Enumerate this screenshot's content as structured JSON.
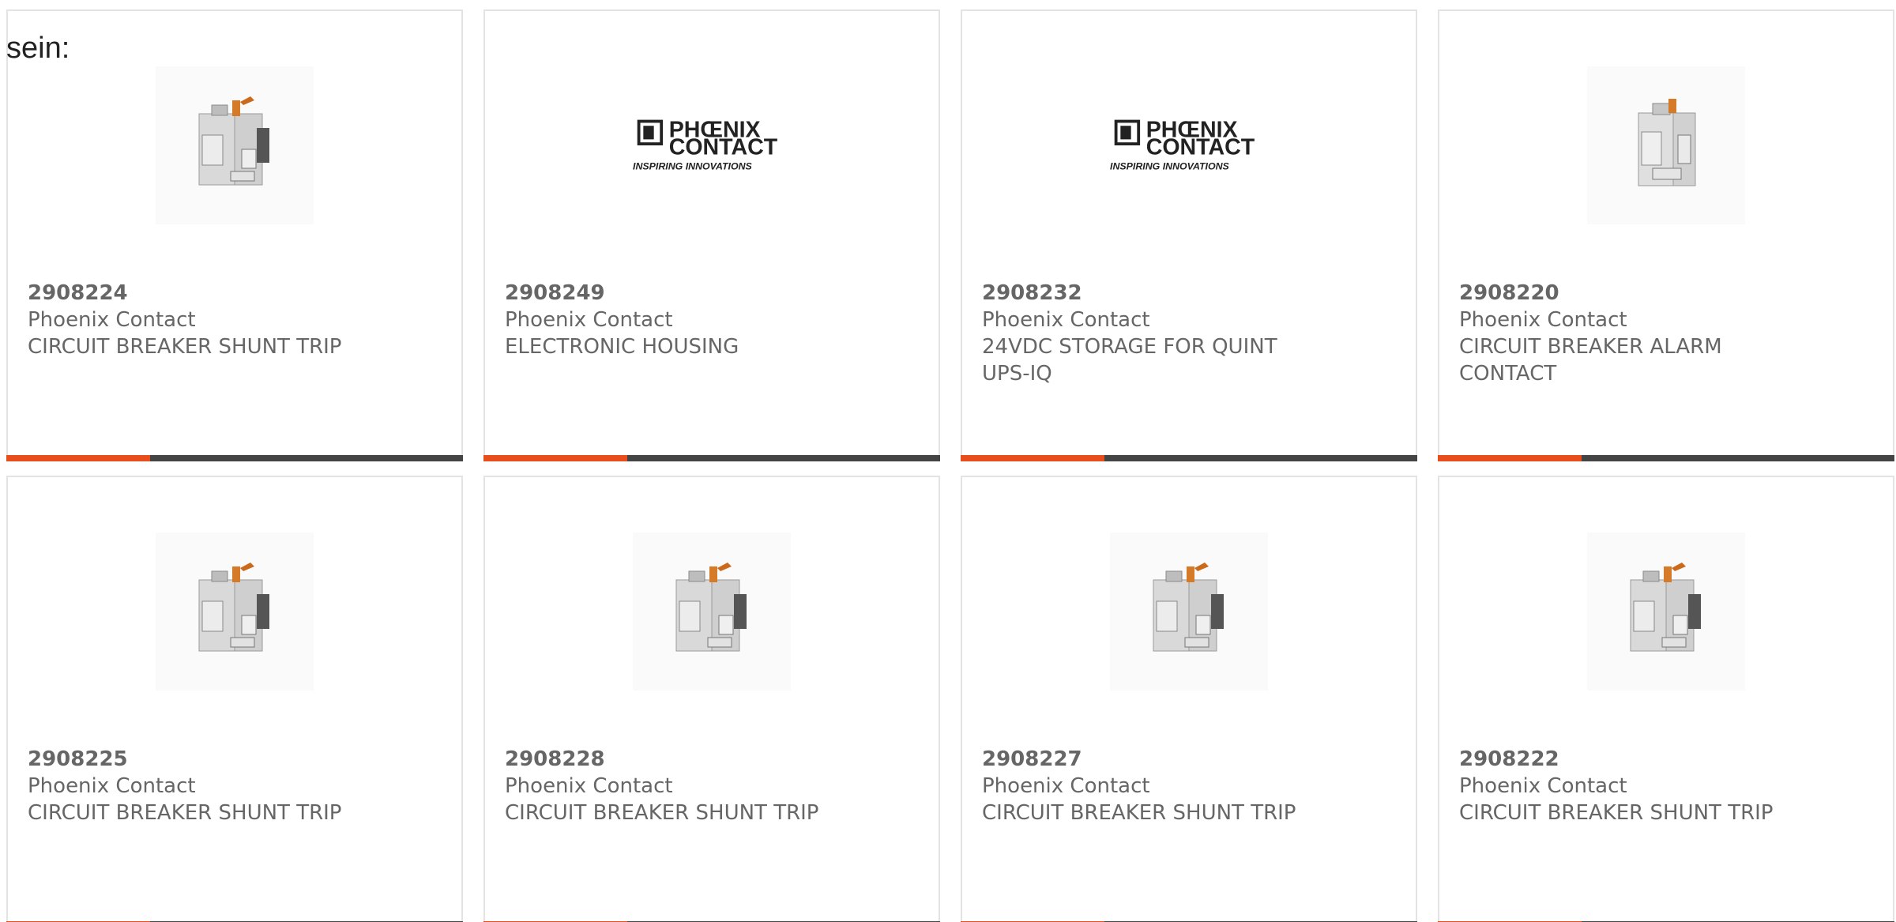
{
  "intro_text": "sein:",
  "products": [
    {
      "part_number": "2908224",
      "manufacturer": "Phoenix Contact",
      "description": "CIRCUIT BREAKER SHUNT TRIP",
      "image": "breaker"
    },
    {
      "part_number": "2908249",
      "manufacturer": "Phoenix Contact",
      "description": "ELECTRONIC HOUSING",
      "image": "logo"
    },
    {
      "part_number": "2908232",
      "manufacturer": "Phoenix Contact",
      "description": "24VDC STORAGE FOR QUINT UPS-IQ",
      "image": "logo"
    },
    {
      "part_number": "2908220",
      "manufacturer": "Phoenix Contact",
      "description": "CIRCUIT BREAKER ALARM CONTACT",
      "image": "breaker-alt"
    },
    {
      "part_number": "2908225",
      "manufacturer": "Phoenix Contact",
      "description": "CIRCUIT BREAKER SHUNT TRIP",
      "image": "breaker"
    },
    {
      "part_number": "2908228",
      "manufacturer": "Phoenix Contact",
      "description": "CIRCUIT BREAKER SHUNT TRIP",
      "image": "breaker"
    },
    {
      "part_number": "2908227",
      "manufacturer": "Phoenix Contact",
      "description": "CIRCUIT BREAKER SHUNT TRIP",
      "image": "breaker"
    },
    {
      "part_number": "2908222",
      "manufacturer": "Phoenix Contact",
      "description": "CIRCUIT BREAKER SHUNT TRIP",
      "image": "breaker"
    }
  ],
  "logo_text": {
    "line1": "PHŒNIX",
    "line2": "CONTACT",
    "tagline": "INSPIRING INNOVATIONS"
  },
  "colors": {
    "accent": "#e84e1b",
    "bar": "#444444",
    "text": "#666666",
    "border": "#e3e3e3"
  }
}
